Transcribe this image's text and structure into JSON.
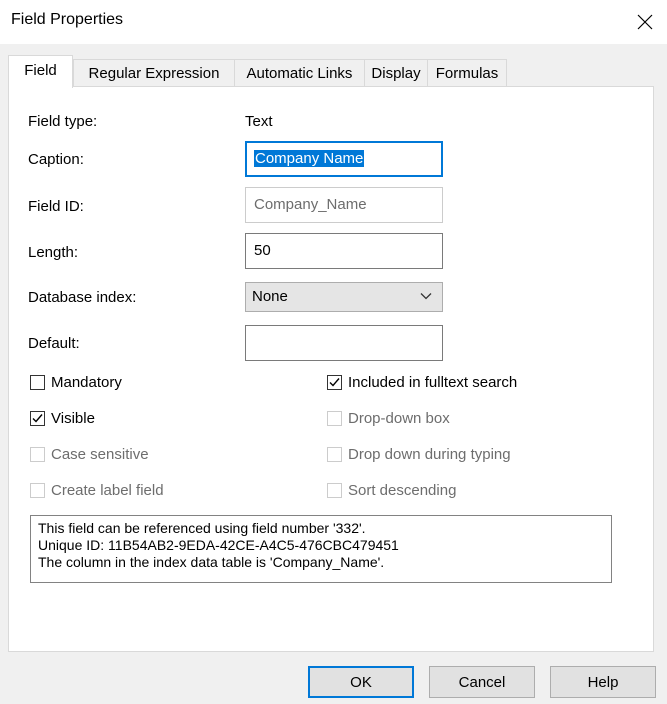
{
  "window": {
    "title": "Field Properties"
  },
  "tabs": [
    {
      "label": "Field",
      "active": true
    },
    {
      "label": "Regular Expression",
      "active": false
    },
    {
      "label": "Automatic Links",
      "active": false
    },
    {
      "label": "Display",
      "active": false
    },
    {
      "label": "Formulas",
      "active": false
    }
  ],
  "form": {
    "field_type_label": "Field type:",
    "field_type_value": "Text",
    "caption_label": "Caption:",
    "caption_value": "Company Name",
    "field_id_label": "Field ID:",
    "field_id_value": "Company_Name",
    "length_label": "Length:",
    "length_value": "50",
    "db_index_label": "Database index:",
    "db_index_value": "None",
    "default_label": "Default:",
    "default_value": ""
  },
  "checkboxes": {
    "mandatory": {
      "label": "Mandatory",
      "checked": false,
      "enabled": true
    },
    "visible": {
      "label": "Visible",
      "checked": true,
      "enabled": true
    },
    "case_sensitive": {
      "label": "Case sensitive",
      "checked": false,
      "enabled": false
    },
    "create_label_field": {
      "label": "Create label field",
      "checked": false,
      "enabled": false
    },
    "included_fulltext": {
      "label": "Included in fulltext search",
      "checked": true,
      "enabled": true
    },
    "drop_down_box": {
      "label": "Drop-down box",
      "checked": false,
      "enabled": false
    },
    "drop_down_typing": {
      "label": "Drop down during typing",
      "checked": false,
      "enabled": false
    },
    "sort_descending": {
      "label": "Sort descending",
      "checked": false,
      "enabled": false
    }
  },
  "info": {
    "line1": "This field can be referenced using field number '332'.",
    "line2": "Unique ID: 11B54AB2-9EDA-42CE-A4C5-476CBC479451",
    "line3": "The column in the index data table is 'Company_Name'."
  },
  "buttons": {
    "ok": "OK",
    "cancel": "Cancel",
    "help": "Help"
  },
  "colors": {
    "accent": "#0078d7",
    "disabled_text": "#6d6d6d"
  },
  "icons": {
    "close": "close-icon",
    "dropdown": "chevron-down-icon",
    "check": "checkmark-icon"
  }
}
